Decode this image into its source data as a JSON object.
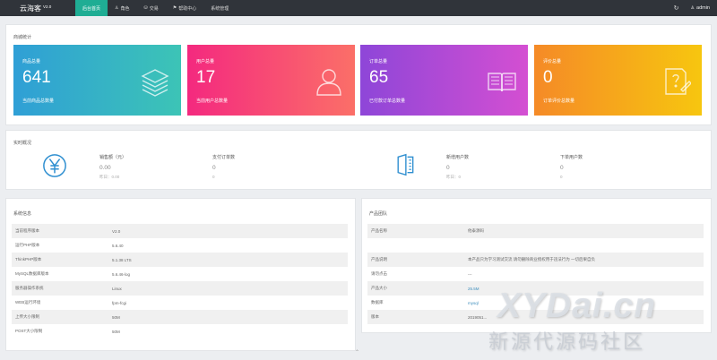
{
  "brand": {
    "name": "云海客",
    "version": "V2.0"
  },
  "nav": [
    {
      "label": "后台首页",
      "icon": "",
      "active": true
    },
    {
      "label": "角色",
      "icon": "♙"
    },
    {
      "label": "交易",
      "icon": "⛁"
    },
    {
      "label": "帮助中心",
      "icon": "⚑"
    },
    {
      "label": "系统管理",
      "icon": ""
    }
  ],
  "top_right": {
    "refresh_icon": "↻",
    "user_icon": "♙",
    "user": "admin"
  },
  "stats_panel": {
    "title": "商城统计",
    "cards": [
      {
        "title": "商品总量",
        "value": "641",
        "sub": "当前商品总数量",
        "icon": "layers-icon",
        "color_from": "#2f9fd6",
        "color_to": "#3cc4b6"
      },
      {
        "title": "用户总量",
        "value": "17",
        "sub": "当前用户总数量",
        "icon": "user-icon",
        "color_from": "#f4297f",
        "color_to": "#fb6f68"
      },
      {
        "title": "订单总量",
        "value": "65",
        "sub": "已付款订单总数量",
        "icon": "book-icon",
        "color_from": "#8e46d8",
        "color_to": "#d44fd2"
      },
      {
        "title": "评价总量",
        "value": "0",
        "sub": "订单评价总数量",
        "icon": "review-icon",
        "color_from": "#f58a27",
        "color_to": "#f7c60f"
      }
    ]
  },
  "realtime": {
    "title": "实时概况",
    "left_icon": "yen-icon",
    "right_icon": "document-icon",
    "metrics": [
      {
        "label": "销售额（元）",
        "value": "0.00",
        "sub": "昨日：0.00"
      },
      {
        "label": "支付订单数",
        "value": "0",
        "sub": "0"
      },
      {
        "label": "新增用户数",
        "value": "0",
        "sub": "昨日：0"
      },
      {
        "label": "下单用户数",
        "value": "0",
        "sub": "0"
      }
    ]
  },
  "system": {
    "title": "系统信息",
    "rows": [
      {
        "k": "当前程序版本",
        "v": "V2.0"
      },
      {
        "k": "运行PHP版本",
        "v": "5.6.40"
      },
      {
        "k": "ThinkPHP版本",
        "v": "5.1.38 LTS"
      },
      {
        "k": "MySQL数据库版本",
        "v": "5.6.46-log"
      },
      {
        "k": "服务器操作系统",
        "v": "Linux"
      },
      {
        "k": "WEB运行环境",
        "v": "fpm-fcgi"
      },
      {
        "k": "上传大小限制",
        "v": "50M"
      },
      {
        "k": "POST大小限制",
        "v": "50M"
      }
    ]
  },
  "product": {
    "title": "产品团队",
    "rows": [
      {
        "k": "产品名称",
        "v": "他泰源码"
      },
      {
        "k": "",
        "v": ""
      },
      {
        "k": "产品说明",
        "v": "本产品只为学习测试交流 请勿删除商业授权用于违法行为 一切后果自负"
      },
      {
        "k": "请勿点击",
        "v": "---"
      },
      {
        "k": "产品大小",
        "v": "25.5M"
      },
      {
        "k": "数据库",
        "v": "mysql"
      },
      {
        "k": "版本",
        "v": "2019051..."
      }
    ]
  },
  "watermark": {
    "line1": "XYDai.cn",
    "line2": "新源代源码社区"
  }
}
